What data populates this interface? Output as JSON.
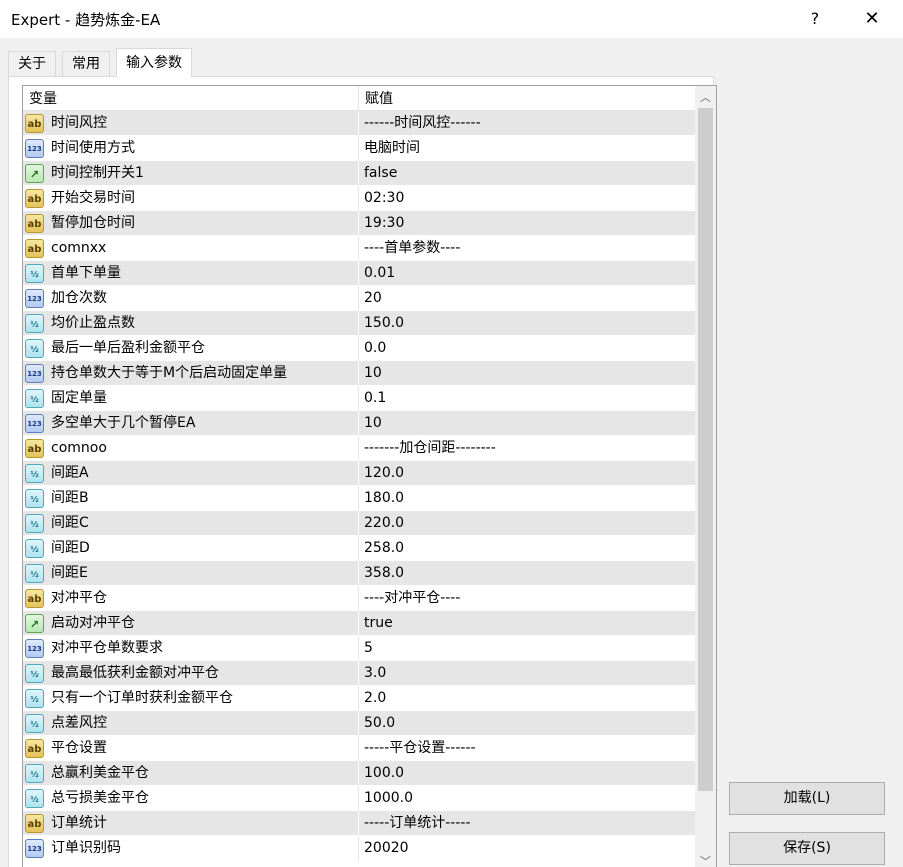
{
  "window": {
    "title": "Expert - 趋势炼金-EA",
    "help_label": "?",
    "close_label": "✕"
  },
  "tabs": [
    {
      "label": "关于"
    },
    {
      "label": "常用"
    },
    {
      "label": "输入参数"
    }
  ],
  "grid": {
    "col_variable": "变量",
    "col_value": "赋值",
    "rows": [
      {
        "type": "ab",
        "name": "时间风控",
        "value": "------时间风控------"
      },
      {
        "type": "123",
        "name": "时间使用方式",
        "value": "电脑时间"
      },
      {
        "type": "bool",
        "name": "时间控制开关1",
        "value": "false"
      },
      {
        "type": "ab",
        "name": "开始交易时间",
        "value": "02:30"
      },
      {
        "type": "ab",
        "name": "暂停加仓时间",
        "value": "19:30"
      },
      {
        "type": "ab",
        "name": "comnxx",
        "value": "----首单参数----"
      },
      {
        "type": "half",
        "name": "首单下单量",
        "value": "0.01"
      },
      {
        "type": "123",
        "name": "加仓次数",
        "value": "20"
      },
      {
        "type": "half",
        "name": "均价止盈点数",
        "value": "150.0"
      },
      {
        "type": "half",
        "name": "最后一单后盈利金额平仓",
        "value": "0.0"
      },
      {
        "type": "123",
        "name": "持仓单数大于等于M个后启动固定单量",
        "value": "10"
      },
      {
        "type": "half",
        "name": "固定单量",
        "value": "0.1"
      },
      {
        "type": "123",
        "name": "多空单大于几个暂停EA",
        "value": "10"
      },
      {
        "type": "ab",
        "name": "comnoo",
        "value": "-------加仓间距--------"
      },
      {
        "type": "half",
        "name": "间距A",
        "value": "120.0"
      },
      {
        "type": "half",
        "name": "间距B",
        "value": "180.0"
      },
      {
        "type": "half",
        "name": "间距C",
        "value": "220.0"
      },
      {
        "type": "half",
        "name": "间距D",
        "value": "258.0"
      },
      {
        "type": "half",
        "name": "间距E",
        "value": "358.0"
      },
      {
        "type": "ab",
        "name": "对冲平仓",
        "value": "----对冲平仓----"
      },
      {
        "type": "bool",
        "name": "启动对冲平仓",
        "value": "true"
      },
      {
        "type": "123",
        "name": "对冲平仓单数要求",
        "value": "5"
      },
      {
        "type": "half",
        "name": "最高最低获利金额对冲平仓",
        "value": "3.0"
      },
      {
        "type": "half",
        "name": "只有一个订单时获利金额平仓",
        "value": "2.0"
      },
      {
        "type": "half",
        "name": "点差风控",
        "value": "50.0"
      },
      {
        "type": "ab",
        "name": "平仓设置",
        "value": "-----平仓设置------"
      },
      {
        "type": "half",
        "name": "总赢利美金平仓",
        "value": "100.0"
      },
      {
        "type": "half",
        "name": "总亏损美金平仓",
        "value": "1000.0"
      },
      {
        "type": "ab",
        "name": "订单统计",
        "value": "-----订单统计-----"
      },
      {
        "type": "123",
        "name": "订单识别码",
        "value": "20020"
      }
    ]
  },
  "icons": {
    "ab": "ab",
    "123": "123",
    "half": "½",
    "bool": "↗"
  },
  "buttons": {
    "load": "加载(L)",
    "save": "保存(S)"
  }
}
